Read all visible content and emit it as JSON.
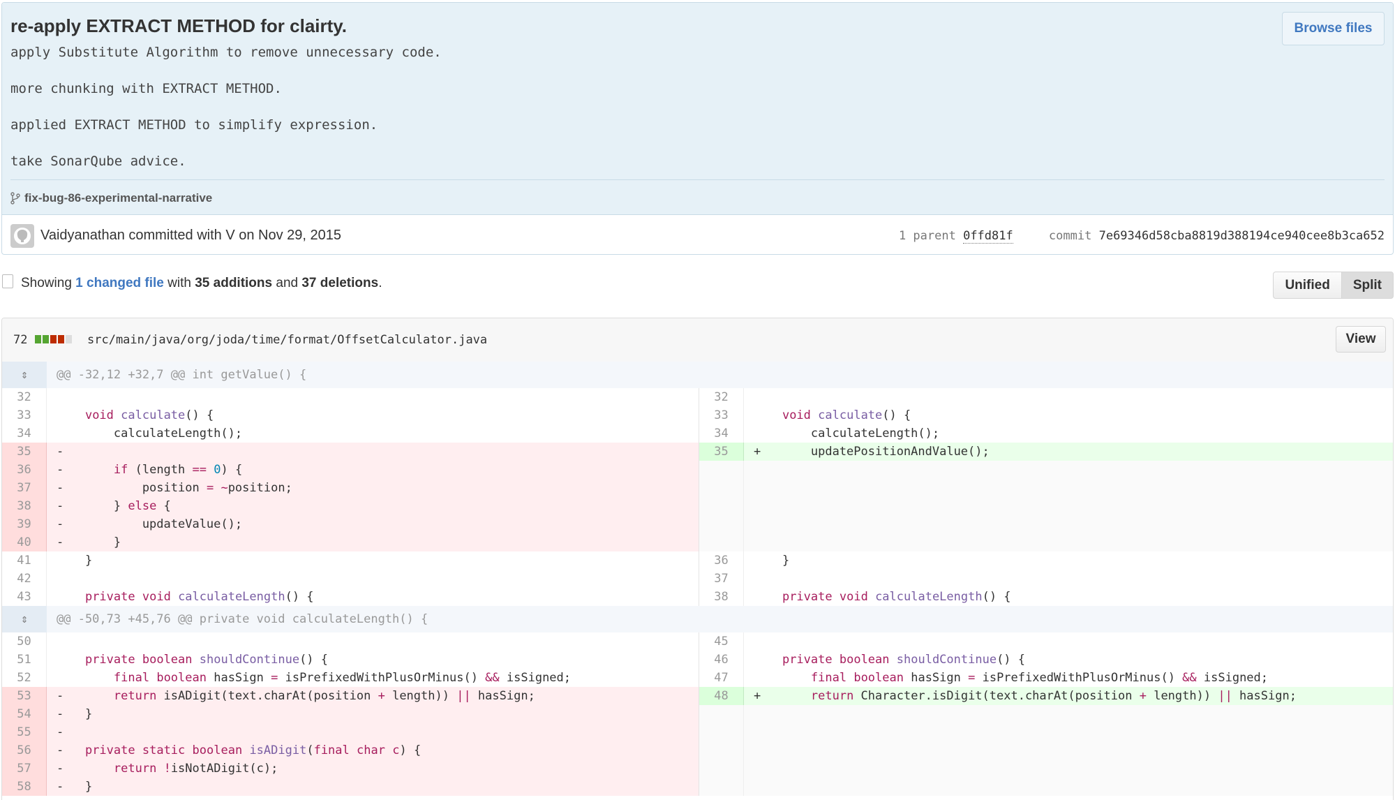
{
  "commit": {
    "title": "re-apply EXTRACT METHOD for clairty.",
    "description": [
      "apply Substitute Algorithm to remove unnecessary code.",
      "more chunking with EXTRACT METHOD.",
      "applied EXTRACT METHOD to simplify expression.",
      "take SonarQube advice."
    ],
    "browse_label": "Browse files",
    "branch": "fix-bug-86-experimental-narrative",
    "author_line": "Vaidyanathan committed with V on Nov 29, 2015",
    "parent_label": "1 parent",
    "parent_sha": "0ffd81f",
    "commit_label": "commit",
    "commit_sha": "7e69346d58cba8819d388194ce940cee8b3ca652"
  },
  "toolbar": {
    "showing": "Showing",
    "changed_files": "1 changed file",
    "with": "with",
    "additions": "35 additions",
    "and": "and",
    "deletions": "37 deletions",
    "period": ".",
    "unified_label": "Unified",
    "split_label": "Split"
  },
  "file": {
    "change_count": "72",
    "path": "src/main/java/org/joda/time/format/OffsetCalculator.java",
    "view_label": "View",
    "colors": {
      "add": "#55a532",
      "del": "#bd2c00",
      "neutral": "#ddd"
    }
  },
  "diff": [
    {
      "type": "hunk",
      "text": "@@ -32,12 +32,7 @@ int getValue() {"
    },
    {
      "l": {
        "n": "32",
        "c": ""
      },
      "r": {
        "n": "32",
        "c": ""
      }
    },
    {
      "l": {
        "n": "33",
        "c": "    <span class=\"kw\">void</span> <span class=\"fn\">calculate</span>() {"
      },
      "r": {
        "n": "33",
        "c": "    <span class=\"kw\">void</span> <span class=\"fn\">calculate</span>() {"
      }
    },
    {
      "l": {
        "n": "34",
        "c": "        calculateLength();"
      },
      "r": {
        "n": "34",
        "c": "        calculateLength();"
      }
    },
    {
      "l": {
        "n": "35",
        "c": "-",
        "t": "del"
      },
      "r": {
        "n": "35",
        "c": "+       updatePositionAndValue();",
        "t": "add"
      }
    },
    {
      "l": {
        "n": "36",
        "c": "-       <span class=\"kw\">if</span> (length <span class=\"op\">==</span> <span class=\"nm\">0</span>) {",
        "t": "del"
      },
      "r": {
        "t": "empty"
      }
    },
    {
      "l": {
        "n": "37",
        "c": "-           position <span class=\"op\">=</span> <span class=\"op\">~</span>position;",
        "t": "del"
      },
      "r": {
        "t": "empty"
      }
    },
    {
      "l": {
        "n": "38",
        "c": "-       } <span class=\"kw\">else</span> {",
        "t": "del"
      },
      "r": {
        "t": "empty"
      }
    },
    {
      "l": {
        "n": "39",
        "c": "-           updateValue();",
        "t": "del"
      },
      "r": {
        "t": "empty"
      }
    },
    {
      "l": {
        "n": "40",
        "c": "-       }",
        "t": "del"
      },
      "r": {
        "t": "empty"
      }
    },
    {
      "l": {
        "n": "41",
        "c": "    }"
      },
      "r": {
        "n": "36",
        "c": "    }"
      }
    },
    {
      "l": {
        "n": "42",
        "c": ""
      },
      "r": {
        "n": "37",
        "c": ""
      }
    },
    {
      "l": {
        "n": "43",
        "c": "    <span class=\"kw\">private</span> <span class=\"kw\">void</span> <span class=\"fn\">calculateLength</span>() {"
      },
      "r": {
        "n": "38",
        "c": "    <span class=\"kw\">private</span> <span class=\"kw\">void</span> <span class=\"fn\">calculateLength</span>() {"
      }
    },
    {
      "type": "hunk",
      "text": "@@ -50,73 +45,76 @@ private void calculateLength() {"
    },
    {
      "l": {
        "n": "50",
        "c": ""
      },
      "r": {
        "n": "45",
        "c": ""
      }
    },
    {
      "l": {
        "n": "51",
        "c": "    <span class=\"kw\">private</span> <span class=\"kw\">boolean</span> <span class=\"fn\">shouldContinue</span>() {"
      },
      "r": {
        "n": "46",
        "c": "    <span class=\"kw\">private</span> <span class=\"kw\">boolean</span> <span class=\"fn\">shouldContinue</span>() {"
      }
    },
    {
      "l": {
        "n": "52",
        "c": "        <span class=\"kw\">final</span> <span class=\"kw\">boolean</span> hasSign <span class=\"op\">=</span> isPrefixedWithPlusOrMinus() <span class=\"op\">&amp;&amp;</span> isSigned;"
      },
      "r": {
        "n": "47",
        "c": "        <span class=\"kw\">final</span> <span class=\"kw\">boolean</span> hasSign <span class=\"op\">=</span> isPrefixedWithPlusOrMinus() <span class=\"op\">&amp;&amp;</span> isSigned;"
      }
    },
    {
      "l": {
        "n": "53",
        "c": "-       <span class=\"kw\">return</span> isADigit(text.charAt(position <span class=\"op\">+</span> length)) <span class=\"op\">||</span> hasSign;",
        "t": "del"
      },
      "r": {
        "n": "48",
        "c": "+       <span class=\"kw\">return</span> Character.isDigit(text.charAt(position <span class=\"op\">+</span> length)) <span class=\"op\">||</span> hasSign;",
        "t": "add"
      }
    },
    {
      "l": {
        "n": "54",
        "c": "-   }",
        "t": "del"
      },
      "r": {
        "t": "empty"
      }
    },
    {
      "l": {
        "n": "55",
        "c": "-",
        "t": "del"
      },
      "r": {
        "t": "empty"
      }
    },
    {
      "l": {
        "n": "56",
        "c": "-   <span class=\"kw\">private</span> <span class=\"kw\">static</span> <span class=\"kw\">boolean</span> <span class=\"fn\">isADigit</span>(<span class=\"kw\">final</span> <span class=\"kw\">char</span> <span class=\"op\">c</span>) {",
        "t": "del"
      },
      "r": {
        "t": "empty"
      }
    },
    {
      "l": {
        "n": "57",
        "c": "-       <span class=\"kw\">return</span> <span class=\"op\">!</span>isNotADigit(c);",
        "t": "del"
      },
      "r": {
        "t": "empty"
      }
    },
    {
      "l": {
        "n": "58",
        "c": "-   }",
        "t": "del"
      },
      "r": {
        "t": "empty"
      }
    }
  ]
}
